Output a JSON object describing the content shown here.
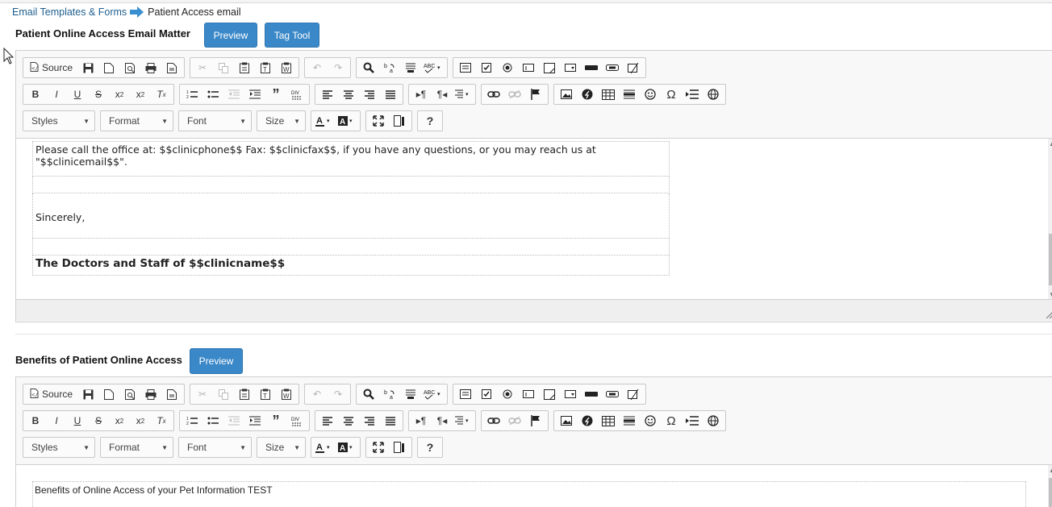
{
  "breadcrumb": {
    "parent": "Email Templates & Forms",
    "current": "Patient Access email"
  },
  "section1": {
    "title": "Patient Online Access Email Matter",
    "preview_label": "Preview",
    "tag_tool_label": "Tag Tool",
    "content": {
      "line1a": "Please call the office at: $$clinicphone$$ Fax: $$clinicfax$$, if you have any questions, or you may reach us at",
      "line1b": "\"$$clinicemail$$\".",
      "closing": "Sincerely,",
      "signature": "The Doctors and Staff of $$clinicname$$"
    }
  },
  "section2": {
    "title": "Benefits of Patient Online Access",
    "preview_label": "Preview",
    "content": {
      "line1": "Benefits of Online Access of your Pet Information TEST"
    }
  },
  "toolbar": {
    "source_label": "Source",
    "styles_label": "Styles",
    "format_label": "Format",
    "font_label": "Font",
    "size_label": "Size",
    "help_label": "?"
  },
  "colors": {
    "accent": "#3a88c8",
    "link": "#1f5f8f",
    "arrow": "#3a8fd0"
  }
}
